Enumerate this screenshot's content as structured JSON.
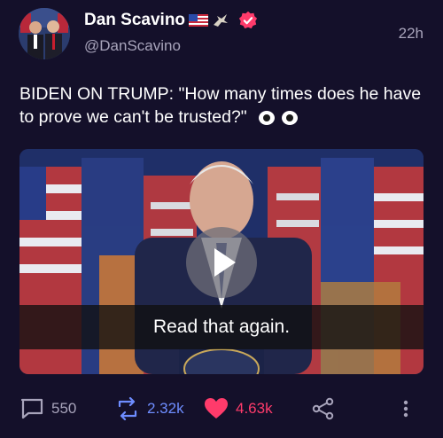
{
  "post": {
    "display_name": "Dan Scavino",
    "handle": "@DanScavino",
    "time": "22h",
    "text": "BIDEN ON TRUMP: \"How many times does he have to prove we can't be trusted?\""
  },
  "media": {
    "caption": "Read that again."
  },
  "actions": {
    "replies": "550",
    "reposts": "2.32k",
    "likes": "4.63k"
  },
  "colors": {
    "background": "#14102a",
    "repost": "#6e8dff",
    "like": "#ff3b6b",
    "secondary_text": "#a8a4bb"
  }
}
